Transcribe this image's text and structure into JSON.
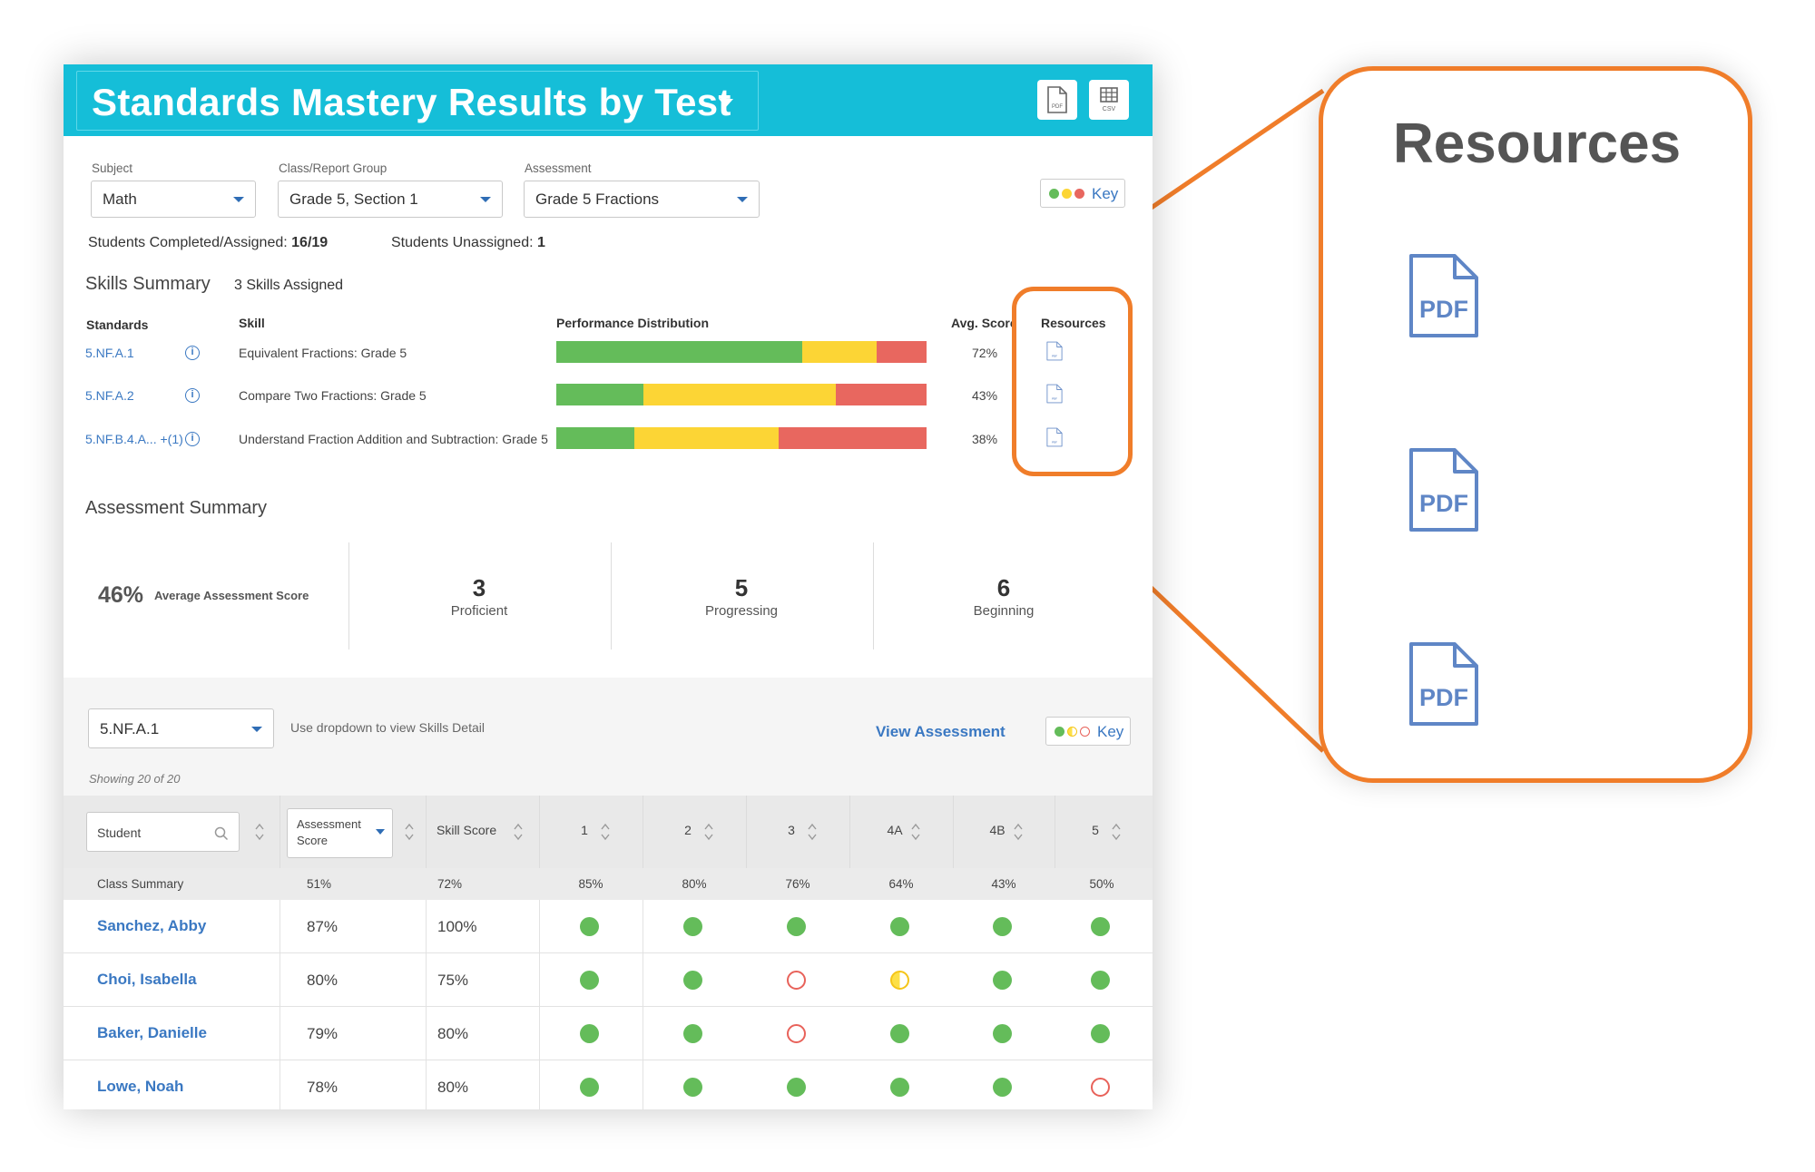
{
  "header": {
    "title": "Standards Mastery Results by Test",
    "pdf_label": "PDF",
    "csv_label": "CSV"
  },
  "filters": {
    "subject": {
      "label": "Subject",
      "value": "Math"
    },
    "group": {
      "label": "Class/Report Group",
      "value": "Grade 5, Section 1"
    },
    "assessment": {
      "label": "Assessment",
      "value": "Grade 5 Fractions"
    }
  },
  "key": {
    "label": "Key"
  },
  "stats": {
    "completed_label": "Students Completed/Assigned:",
    "completed_value": "16/19",
    "unassigned_label": "Students Unassigned:",
    "unassigned_value": "1"
  },
  "skills_summary": {
    "title": "Skills Summary",
    "assigned": "3 Skills Assigned",
    "headers": {
      "standards": "Standards",
      "skill": "Skill",
      "distribution": "Performance Distribution",
      "avg": "Avg. Score",
      "resources": "Resources"
    },
    "rows": [
      {
        "standard": "5.NF.A.1",
        "skill": "Equivalent Fractions: Grade 5",
        "dist": [
          0.665,
          0.2,
          0.135
        ],
        "avg": "72%"
      },
      {
        "standard": "5.NF.A.2",
        "skill": "Compare Two Fractions: Grade 5",
        "dist": [
          0.235,
          0.52,
          0.245
        ],
        "avg": "43%"
      },
      {
        "standard": "5.NF.B.4.A... +(1)",
        "skill": "Understand Fraction Addition and Subtraction: Grade 5",
        "dist": [
          0.21,
          0.39,
          0.4
        ],
        "avg": "38%"
      }
    ]
  },
  "assessment_summary": {
    "title": "Assessment Summary",
    "avg_value": "46%",
    "avg_label": "Average Assessment Score",
    "proficient": {
      "value": "3",
      "label": "Proficient"
    },
    "progressing": {
      "value": "5",
      "label": "Progressing"
    },
    "beginning": {
      "value": "6",
      "label": "Beginning"
    }
  },
  "detail": {
    "dropdown_value": "5.NF.A.1",
    "hint": "Use dropdown to view Skills Detail",
    "view_link": "View Assessment",
    "showing": "Showing 20 of 20",
    "table_headers": {
      "student": "Student",
      "assessment_score_1": "Assessment",
      "assessment_score_2": "Score",
      "skill_score": "Skill Score",
      "items": [
        "1",
        "2",
        "3",
        "4A",
        "4B",
        "5"
      ]
    },
    "class_summary": {
      "label": "Class Summary",
      "assessment": "51%",
      "skill": "72%",
      "items": [
        "85%",
        "80%",
        "76%",
        "64%",
        "43%",
        "50%"
      ]
    },
    "students": [
      {
        "name": "Sanchez, Abby",
        "assessment": "87%",
        "skill": "100%",
        "marks": [
          "proficient",
          "proficient",
          "proficient",
          "proficient",
          "proficient",
          "proficient"
        ]
      },
      {
        "name": "Choi, Isabella",
        "assessment": "80%",
        "skill": "75%",
        "marks": [
          "proficient",
          "proficient",
          "beginning",
          "progressing",
          "proficient",
          "proficient"
        ]
      },
      {
        "name": "Baker, Danielle",
        "assessment": "79%",
        "skill": "80%",
        "marks": [
          "proficient",
          "proficient",
          "beginning",
          "proficient",
          "proficient",
          "proficient"
        ]
      },
      {
        "name": "Lowe, Noah",
        "assessment": "78%",
        "skill": "80%",
        "marks": [
          "proficient",
          "proficient",
          "proficient",
          "proficient",
          "proficient",
          "beginning"
        ]
      }
    ]
  },
  "callout": {
    "title": "Resources",
    "pdf_label": "PDF"
  },
  "colors": {
    "proficient": "#64bc5a",
    "progressing": "#fcd535",
    "beginning": "#e8675f",
    "accent": "#f07d2a",
    "header": "#15bed8",
    "link": "#3a78c2"
  }
}
